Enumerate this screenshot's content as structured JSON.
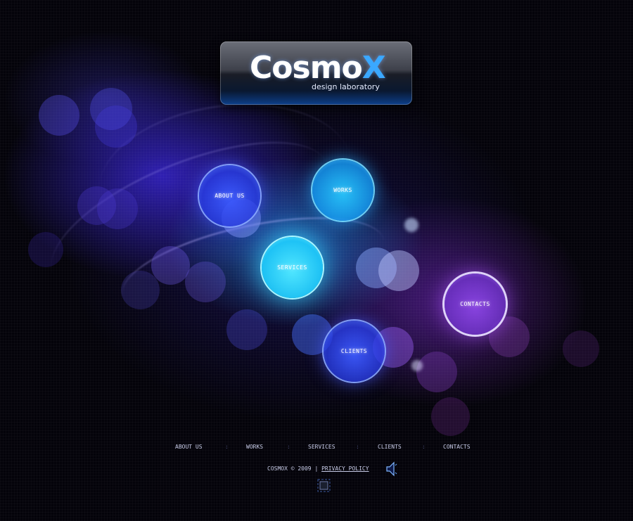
{
  "logo": {
    "title_main": "Cosmo",
    "title_accent": "X",
    "tagline": "design laboratory"
  },
  "bubbles": {
    "about": "ABOUT US",
    "works": "WORKS",
    "services": "SERVICES",
    "clients": "CLIENTS",
    "contacts": "CONTACTS"
  },
  "nav": {
    "items": [
      "ABOUT US",
      "WORKS",
      "SERVICES",
      "CLIENTS",
      "CONTACTS"
    ],
    "separator": ":"
  },
  "footer": {
    "copyright": "COSMOX © 2009",
    "divider": "|",
    "privacy": "PRIVACY POLICY"
  },
  "icons": {
    "sound": "speaker-icon",
    "stop": "stop-icon"
  },
  "colors": {
    "background": "#04030a",
    "accent_cyan": "#3aa8ff",
    "bubble_blue": "#3c5aff",
    "bubble_cyan": "#28c8ff",
    "bubble_violet": "#8c46e6",
    "nav_text": "#c8cce8"
  }
}
